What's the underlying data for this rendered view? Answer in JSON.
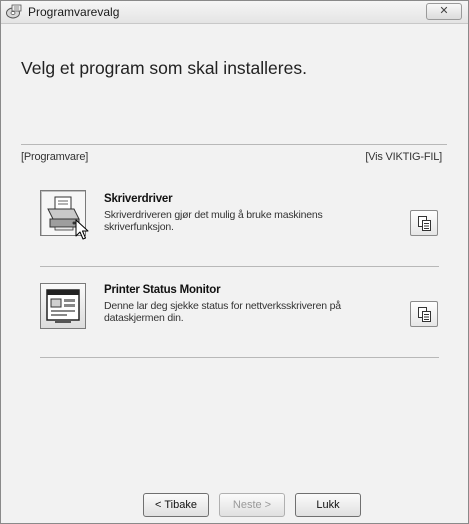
{
  "window": {
    "title": "Programvarevalg",
    "close_label": "✕"
  },
  "heading": "Velg et program som skal installeres.",
  "section": {
    "left_label": "[Programvare]",
    "right_label": "[Vis VIKTIG-FIL]"
  },
  "items": [
    {
      "title": "Skriverdriver",
      "description": "Skriverdriveren gjør det mulig å bruke maskinens skriverfunksjon.",
      "icon": "printer-icon"
    },
    {
      "title": "Printer Status Monitor",
      "description": "Denne lar deg sjekke status for nettverksskriveren på dataskjermen din.",
      "icon": "status-monitor-icon"
    }
  ],
  "buttons": {
    "back": "< Tibake",
    "next": "Neste >",
    "close": "Lukk"
  }
}
